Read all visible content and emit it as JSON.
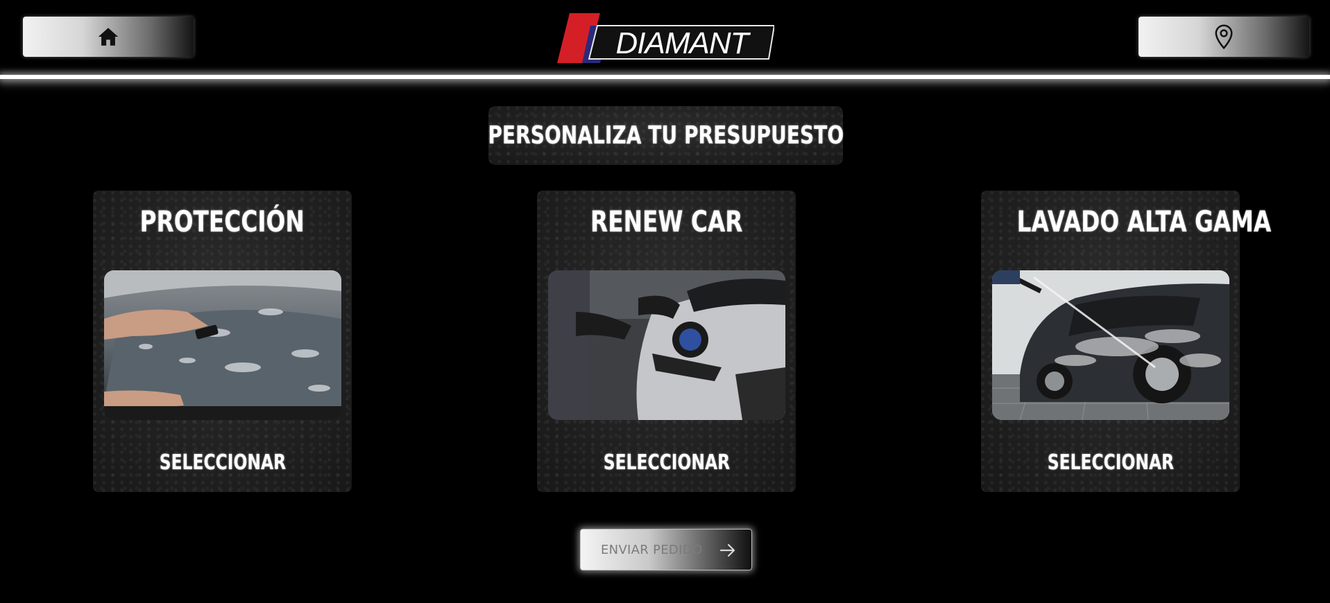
{
  "header": {
    "home_icon": "home-icon",
    "location_icon": "map-pin-icon",
    "logo_text": "DIAMANT",
    "logo_colors": {
      "red": "#d41f26",
      "blue": "#2b2a7a"
    }
  },
  "heading": "PERSONALIZA TU PRESUPUESTO",
  "cards": [
    {
      "title": "PROTECCIÓN",
      "image": "car-hood-protection-photo",
      "select_label": "SELECCIONAR"
    },
    {
      "title": "RENEW CAR",
      "image": "car-polishing-photo",
      "select_label": "SELECCIONAR"
    },
    {
      "title": "LAVADO ALTA GAMA",
      "image": "car-pressure-wash-photo",
      "select_label": "SELECCIONAR"
    }
  ],
  "submit": {
    "label": "ENVIAR PEDIDO",
    "icon": "arrow-right-icon"
  }
}
